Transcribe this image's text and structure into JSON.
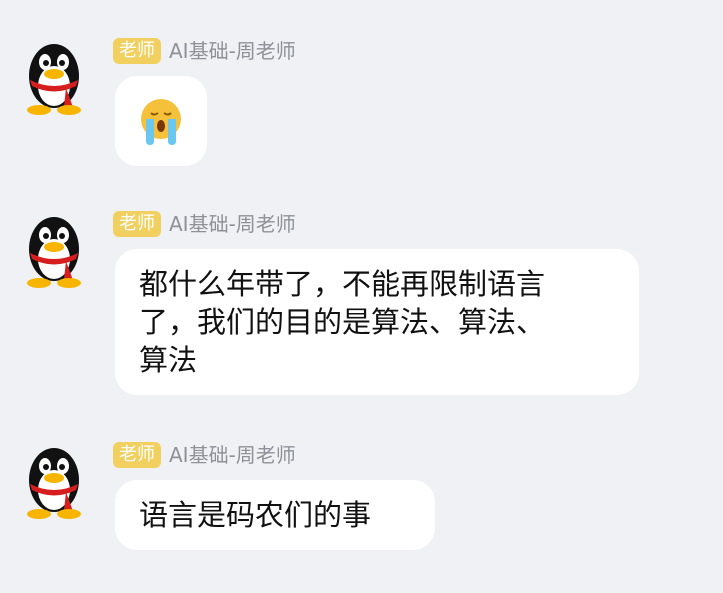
{
  "messages": [
    {
      "role_badge": "老师",
      "sender": "AI基础-周老师",
      "content_type": "emoji",
      "emoji": "crying-face-emoji"
    },
    {
      "role_badge": "老师",
      "sender": "AI基础-周老师",
      "content_type": "text",
      "lines": [
        "都什么年带了，不能再限制语言",
        "了，我们的目的是算法、算法、",
        "算法"
      ]
    },
    {
      "role_badge": "老师",
      "sender": "AI基础-周老师",
      "content_type": "text",
      "lines": [
        "语言是码农们的事"
      ]
    }
  ],
  "colors": {
    "background": "#f0f1f5",
    "badge": "#f2d060",
    "bubble": "#ffffff",
    "sender_text": "#8f9198"
  },
  "icons": {
    "avatar": "qq-penguin-avatar"
  }
}
